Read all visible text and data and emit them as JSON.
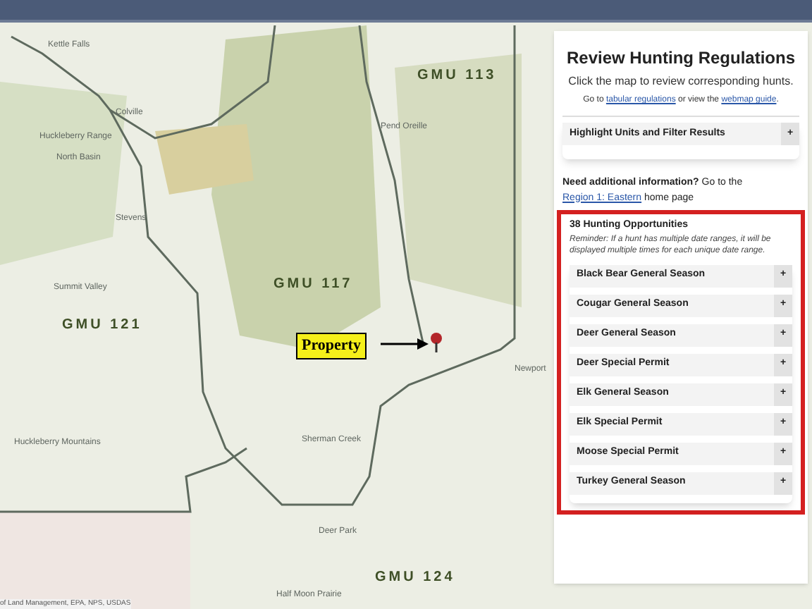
{
  "map": {
    "labels": [
      {
        "kind": "place",
        "text": "Kettle Falls"
      },
      {
        "kind": "place",
        "text": "Colville"
      },
      {
        "kind": "gmu",
        "text": "GMU 113"
      },
      {
        "kind": "place",
        "text": "Huckleberry Range"
      },
      {
        "kind": "place",
        "text": "North Basin"
      },
      {
        "kind": "place",
        "text": "Stevens"
      },
      {
        "kind": "place",
        "text": "Summit Valley"
      },
      {
        "kind": "gmu",
        "text": "GMU 117"
      },
      {
        "kind": "gmu",
        "text": "GMU 121"
      },
      {
        "kind": "place",
        "text": "Pend Oreille"
      },
      {
        "kind": "place",
        "text": "Newport"
      },
      {
        "kind": "place",
        "text": "Sherman Creek"
      },
      {
        "kind": "place",
        "text": "Huckleberry Mountains"
      },
      {
        "kind": "place",
        "text": "Deer Park"
      },
      {
        "kind": "gmu",
        "text": "GMU 124"
      },
      {
        "kind": "place",
        "text": "Half Moon Prairie"
      }
    ],
    "callout": "Property",
    "attribution": "of Land Management, EPA, NPS, USDAS"
  },
  "panel": {
    "title": "Review Hunting Regulations",
    "subtitle": "Click the map to review corresponding hunts.",
    "goto_text": [
      "Go to ",
      "tabular regulations",
      " or view the ",
      "webmap guide",
      "."
    ],
    "filter": {
      "label": "Highlight Units and Filter Results",
      "symbol": "+"
    },
    "info": {
      "bold": "Need additional information?",
      "text": " Go to the ",
      "link": "Region 1: Eastern",
      "after": " home page"
    },
    "hunts": {
      "heading": "38 Hunting Opportunities",
      "reminder": "Reminder: If a hunt has multiple date ranges, it will be displayed multiple times for each unique date range.",
      "items": [
        {
          "label": "Black Bear General Season",
          "symbol": "+"
        },
        {
          "label": "Cougar General Season",
          "symbol": "+"
        },
        {
          "label": "Deer General Season",
          "symbol": "+"
        },
        {
          "label": "Deer Special Permit",
          "symbol": "+"
        },
        {
          "label": "Elk General Season",
          "symbol": "+"
        },
        {
          "label": "Elk Special Permit",
          "symbol": "+"
        },
        {
          "label": "Moose Special Permit",
          "symbol": "+"
        },
        {
          "label": "Turkey General Season",
          "symbol": "+"
        }
      ]
    }
  }
}
